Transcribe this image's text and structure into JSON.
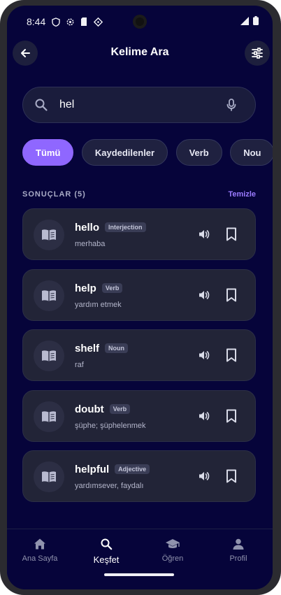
{
  "status_bar": {
    "time": "8:44"
  },
  "header": {
    "title": "Kelime Ara"
  },
  "search": {
    "value": "hel",
    "placeholder": ""
  },
  "filters": [
    "Tümü",
    "Kaydedilenler",
    "Verb",
    "Nou"
  ],
  "results": {
    "title": "SONUÇLAR (5)",
    "clear_label": "Temizle",
    "items": [
      {
        "word": "hello",
        "pos": "Interjection",
        "meaning": "merhaba"
      },
      {
        "word": "help",
        "pos": "Verb",
        "meaning": "yardım etmek"
      },
      {
        "word": "shelf",
        "pos": "Noun",
        "meaning": "raf"
      },
      {
        "word": "doubt",
        "pos": "Verb",
        "meaning": "şüphe; şüphelenmek"
      },
      {
        "word": "helpful",
        "pos": "Adjective",
        "meaning": "yardımsever, faydalı"
      }
    ]
  },
  "nav": {
    "items": [
      {
        "label": "Ana Sayfa",
        "icon": "home-icon"
      },
      {
        "label": "Keşfet",
        "icon": "search-icon",
        "active": true
      },
      {
        "label": "Öğren",
        "icon": "school-icon"
      },
      {
        "label": "Profil",
        "icon": "person-icon"
      }
    ]
  },
  "colors": {
    "background": "#06043a",
    "accent": "#8f67ff",
    "card": "#222437"
  }
}
